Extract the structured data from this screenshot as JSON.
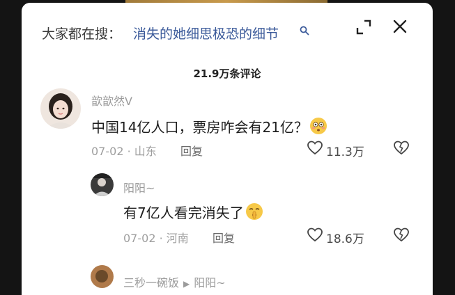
{
  "search": {
    "prefix": "大家都在搜：",
    "query": "消失的她细思极恐的细节"
  },
  "comments_count": "21.9万条评论",
  "comments": [
    {
      "username": "歆歆然V",
      "text": "中国14亿人口，票房咋会有21亿？",
      "date_location": "07-02 · 山东",
      "reply_label": "回复",
      "likes": "11.3万"
    },
    {
      "username": "阳阳~",
      "text": "有7亿人看完消失了",
      "date_location": "07-02 · 河南",
      "reply_label": "回复",
      "likes": "18.6万"
    },
    {
      "username": "三秒一碗饭",
      "reply_to": "阳阳~"
    }
  ],
  "colors": {
    "link": "#3b5a9a",
    "muted": "#9b9b9b",
    "text": "#1e1e1e"
  }
}
